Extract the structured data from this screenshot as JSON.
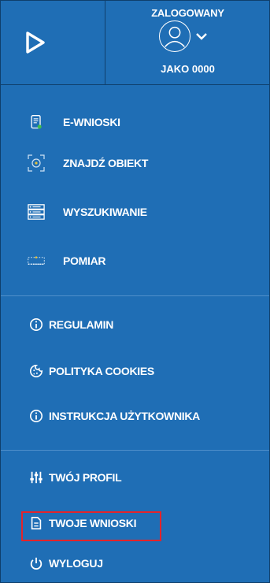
{
  "header": {
    "logged_label": "ZALOGOWANY",
    "user_name": "JAKO 0000"
  },
  "menu_main": [
    {
      "label": "E-WNIOSKI",
      "icon": "document-list-icon"
    },
    {
      "label": "ZNAJDŹ OBIEKT",
      "icon": "find-object-icon"
    },
    {
      "label": "WYSZUKIWANIE",
      "icon": "search-list-icon"
    },
    {
      "label": "POMIAR",
      "icon": "measure-icon"
    }
  ],
  "menu_info": [
    {
      "label": "REGULAMIN",
      "icon": "info-icon"
    },
    {
      "label": "POLITYKA COOKIES",
      "icon": "cookie-icon"
    },
    {
      "label": "INSTRUKCJA UŻYTKOWNIKA",
      "icon": "info-icon"
    }
  ],
  "menu_account": [
    {
      "label": "TWÓJ PROFIL",
      "icon": "sliders-icon"
    },
    {
      "label": "TWOJE WNIOSKI",
      "icon": "document-icon"
    },
    {
      "label": "WYLOGUJ",
      "icon": "power-icon"
    }
  ],
  "colors": {
    "background": "#1f6eb5",
    "highlight": "#e3242b"
  }
}
